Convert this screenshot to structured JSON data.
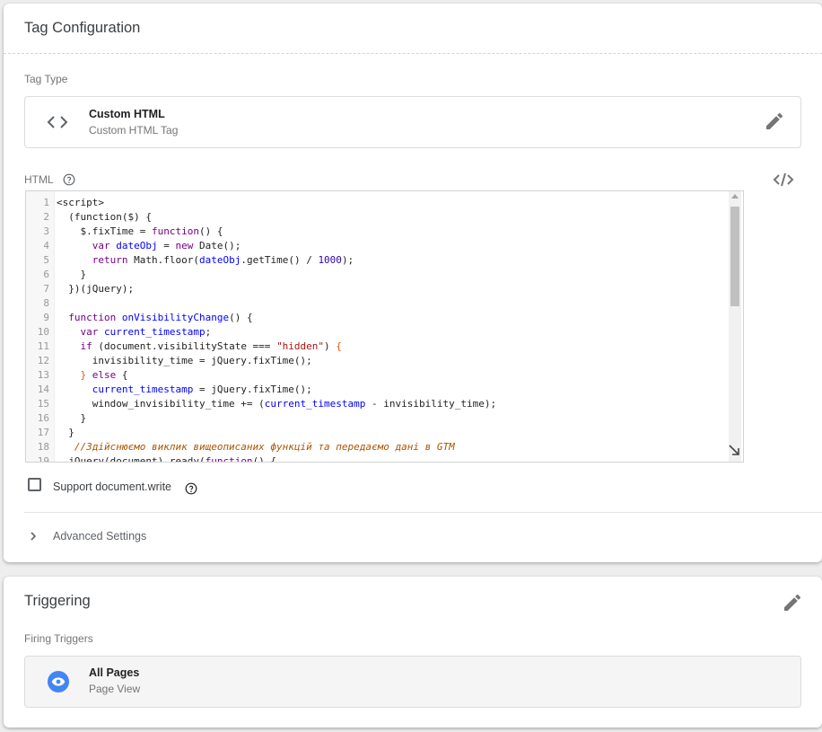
{
  "tag_configuration": {
    "title": "Tag Configuration",
    "tag_type_label": "Tag Type",
    "tag_type": {
      "name": "Custom HTML",
      "description": "Custom HTML Tag",
      "icon": "code-brackets-icon"
    },
    "html_label": "HTML",
    "code_lines": [
      {
        "n": "1",
        "segs": [
          [
            "",
            "<script>"
          ]
        ]
      },
      {
        "n": "2",
        "segs": [
          [
            "",
            "  (function($) {"
          ]
        ]
      },
      {
        "n": "3",
        "segs": [
          [
            "",
            "    $.fixTime = "
          ],
          [
            "cm-kw",
            "function"
          ],
          [
            "",
            "() {"
          ]
        ]
      },
      {
        "n": "4",
        "segs": [
          [
            "",
            "      "
          ],
          [
            "cm-kw",
            "var"
          ],
          [
            "",
            " "
          ],
          [
            "cm-def",
            "dateObj"
          ],
          [
            "",
            " = "
          ],
          [
            "cm-kw",
            "new"
          ],
          [
            "",
            " Date();"
          ]
        ]
      },
      {
        "n": "5",
        "segs": [
          [
            "",
            "      "
          ],
          [
            "cm-kw",
            "return"
          ],
          [
            "",
            " Math.floor("
          ],
          [
            "cm-def",
            "dateObj"
          ],
          [
            "",
            ".getTime() / "
          ],
          [
            "cm-kw2",
            "1000"
          ],
          [
            "",
            ");"
          ]
        ]
      },
      {
        "n": "6",
        "segs": [
          [
            "",
            "    }"
          ]
        ]
      },
      {
        "n": "7",
        "segs": [
          [
            "",
            "  })(jQuery);"
          ]
        ]
      },
      {
        "n": "8",
        "segs": [
          [
            "",
            ""
          ]
        ]
      },
      {
        "n": "9",
        "segs": [
          [
            "",
            "  "
          ],
          [
            "cm-kw",
            "function"
          ],
          [
            "",
            " "
          ],
          [
            "cm-def",
            "onVisibilityChange"
          ],
          [
            "",
            "() {"
          ]
        ]
      },
      {
        "n": "10",
        "segs": [
          [
            "",
            "    "
          ],
          [
            "cm-kw",
            "var"
          ],
          [
            "",
            " "
          ],
          [
            "cm-def",
            "current_timestamp"
          ],
          [
            "",
            ";"
          ]
        ]
      },
      {
        "n": "11",
        "segs": [
          [
            "",
            "    "
          ],
          [
            "cm-kw",
            "if"
          ],
          [
            "",
            " (document.visibilityState === "
          ],
          [
            "cm-str",
            "\"hidden\""
          ],
          [
            "",
            ") "
          ],
          [
            "cm-br",
            "{"
          ]
        ]
      },
      {
        "n": "12",
        "segs": [
          [
            "",
            "      invisibility_time = jQuery.fixTime();"
          ]
        ]
      },
      {
        "n": "13",
        "segs": [
          [
            "",
            "    "
          ],
          [
            "cm-br",
            "}"
          ],
          [
            "",
            " "
          ],
          [
            "cm-kw",
            "else"
          ],
          [
            "",
            " {"
          ]
        ]
      },
      {
        "n": "14",
        "segs": [
          [
            "",
            "      "
          ],
          [
            "cm-def",
            "current_timestamp"
          ],
          [
            "",
            " = jQuery.fixTime();"
          ]
        ]
      },
      {
        "n": "15",
        "segs": [
          [
            "",
            "      window_invisibility_time += ("
          ],
          [
            "cm-def",
            "current_timestamp"
          ],
          [
            "",
            " - invisibility_time);"
          ]
        ]
      },
      {
        "n": "16",
        "segs": [
          [
            "",
            "    }"
          ]
        ]
      },
      {
        "n": "17",
        "segs": [
          [
            "",
            "  }"
          ]
        ]
      },
      {
        "n": "18",
        "segs": [
          [
            "",
            "   "
          ],
          [
            "cm-com",
            "//Здійснюємо виклик вищеописаних функцій та передаємо дані в GTM"
          ]
        ]
      },
      {
        "n": "19",
        "segs": [
          [
            "",
            "  jQuery(document).ready("
          ],
          [
            "cm-kw",
            "function"
          ],
          [
            "",
            "() {"
          ]
        ]
      }
    ],
    "support_document_write": {
      "label": "Support document.write",
      "checked": false
    },
    "advanced_settings_label": "Advanced Settings"
  },
  "triggering": {
    "title": "Triggering",
    "firing_triggers_label": "Firing Triggers",
    "trigger": {
      "name": "All Pages",
      "type": "Page View",
      "icon": "eye-icon",
      "icon_color": "#4285f4"
    }
  },
  "colors": {
    "accent": "#4285f4",
    "icon_gray": "#757575"
  }
}
